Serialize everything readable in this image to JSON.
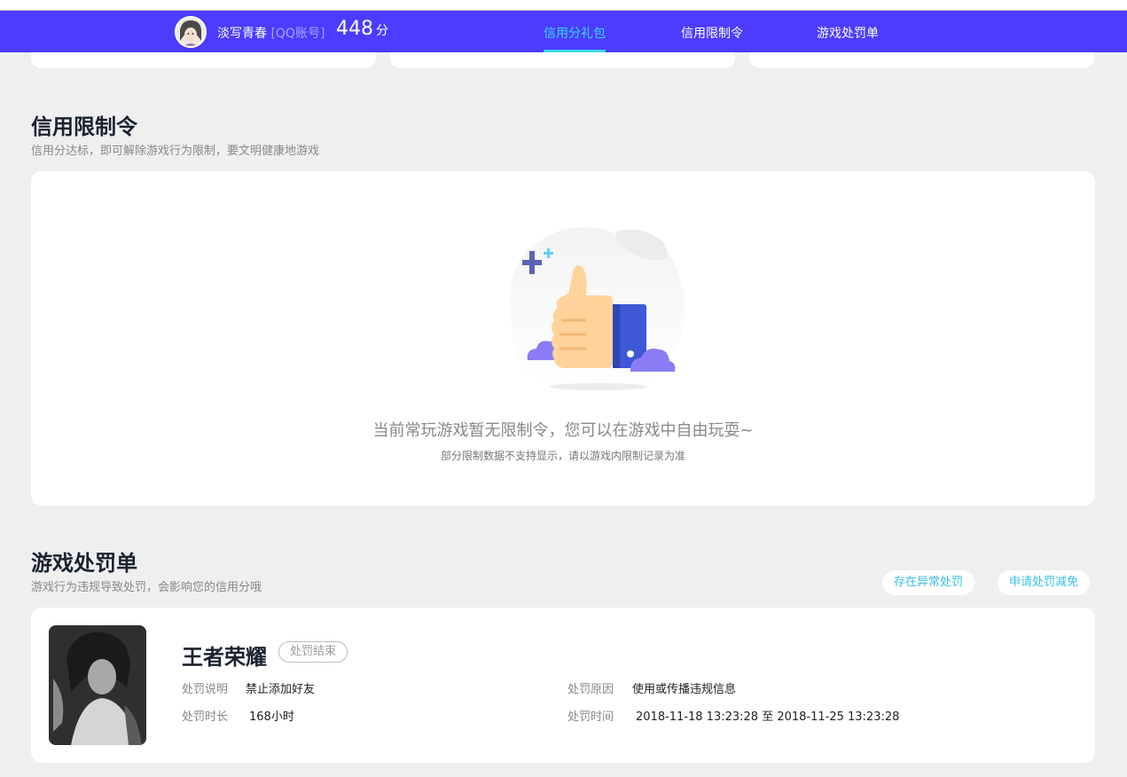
{
  "header": {
    "nickname": "淡写青春",
    "account_type": "[QQ账号]",
    "score": "448",
    "score_unit": "分",
    "tabs": [
      {
        "label": "信用分礼包",
        "active": true
      },
      {
        "label": "信用限制令",
        "active": false
      },
      {
        "label": "游戏处罚单",
        "active": false
      }
    ]
  },
  "restriction": {
    "title": "信用限制令",
    "subtitle": "信用分达标，即可解除游戏行为限制，要文明健康地游戏",
    "empty_main": "当前常玩游戏暂无限制令，您可以在游戏中自由玩耍~",
    "empty_sub": "部分限制数据不支持显示，请以游戏内限制记录为准"
  },
  "penalty": {
    "title": "游戏处罚单",
    "subtitle": "游戏行为违规导致处罚，会影响您的信用分哦",
    "buttons": {
      "abnormal": "存在异常处罚",
      "reduce": "申请处罚减免"
    },
    "record": {
      "game": "王者荣耀",
      "status": "处罚结束",
      "desc_label": "处罚说明",
      "desc_value": "禁止添加好友",
      "duration_label": "处罚时长",
      "duration_value": "168小时",
      "reason_label": "处罚原因",
      "reason_value": "使用或传播违规信息",
      "time_label": "处罚时间",
      "time_value": "2018-11-18 13:23:28 至 2018-11-25 13:23:28"
    }
  },
  "colors": {
    "nav_bg": "#4b3cff",
    "accent": "#38d9f5",
    "button_text": "#38c0e6",
    "page_bg": "#efefef"
  }
}
